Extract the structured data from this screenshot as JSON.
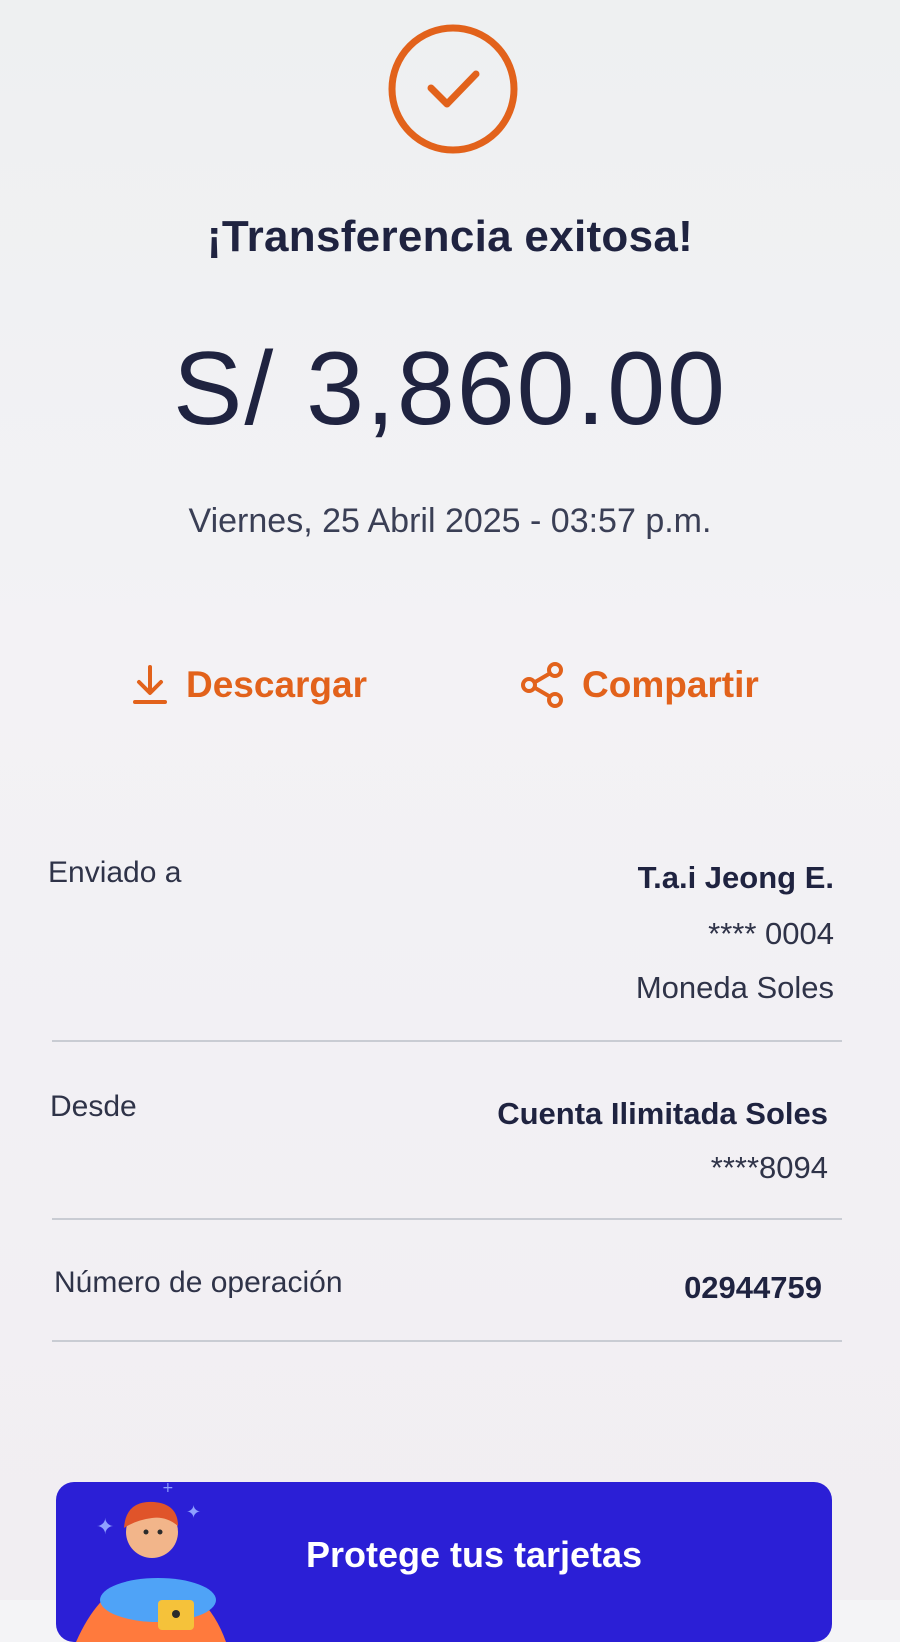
{
  "header": {
    "success_icon": "check-circle-icon",
    "title": "¡Transferencia exitosa!",
    "amount": "S/ 3,860.00",
    "datetime": "Viernes, 25 Abril 2025 - 03:57 p.m."
  },
  "actions": {
    "download_label": "Descargar",
    "download_icon": "download-icon",
    "share_label": "Compartir",
    "share_icon": "share-icon"
  },
  "details": {
    "sent_to": {
      "label": "Enviado a",
      "name": "T.a.i Jeong E.",
      "account": "**** 0004",
      "currency": "Moneda Soles"
    },
    "from": {
      "label": "Desde",
      "account_name": "Cuenta Ilimitada Soles",
      "account": "****8094"
    },
    "operation": {
      "label": "Número de operación",
      "number": "02944759"
    }
  },
  "promo": {
    "title": "Protege tus tarjetas",
    "illustration_icon": "person-with-card-icon"
  },
  "colors": {
    "accent": "#e2621b",
    "text_dark": "#1f2340",
    "promo_bg": "#2b1fd6"
  }
}
